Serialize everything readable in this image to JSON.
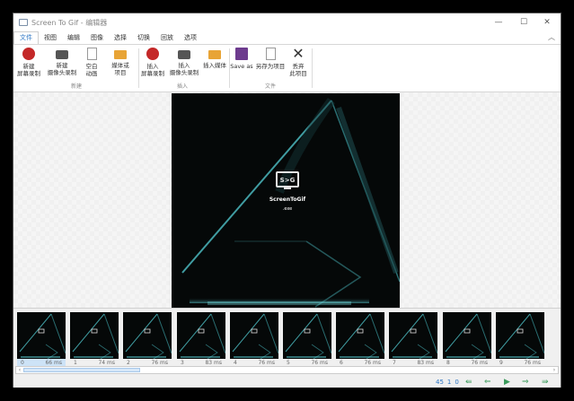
{
  "window": {
    "title": "Screen To Gif - 编辑器"
  },
  "controls": {
    "minimize": "—",
    "maximize": "☐",
    "close": "✕"
  },
  "tabs": [
    "文件",
    "视图",
    "编辑",
    "图像",
    "选择",
    "切换",
    "回放",
    "选项"
  ],
  "ribbon": {
    "new_group": "新建",
    "insert_group": "插入",
    "file_group": "文件",
    "buttons": [
      {
        "line1": "新建",
        "line2": "屏幕录制",
        "icon": "record-icon"
      },
      {
        "line1": "新建",
        "line2": "摄像头录制",
        "icon": "camera-icon"
      },
      {
        "line1": "空白",
        "line2": "动画",
        "icon": "blank-page-icon"
      },
      {
        "line1": "媒体或",
        "line2": "项目",
        "icon": "folder-icon"
      },
      {
        "line1": "插入",
        "line2": "屏幕录制",
        "icon": "record-add-icon"
      },
      {
        "line1": "插入",
        "line2": "摄像头录制",
        "icon": "camera-add-icon"
      },
      {
        "line1": "插入媒体",
        "line2": "",
        "icon": "folder-insert-icon"
      },
      {
        "line1": "Save as",
        "line2": "",
        "icon": "save-icon"
      },
      {
        "line1": "另存为项目",
        "line2": "",
        "icon": "project-file-icon"
      },
      {
        "line1": "丢弃",
        "line2": "此项目",
        "icon": "discard-icon"
      }
    ]
  },
  "frame": {
    "logo_title": "ScreenToGif",
    "logo_sub": ".exe"
  },
  "timeline": {
    "frames": [
      {
        "index": "0",
        "delay": "66 ms"
      },
      {
        "index": "1",
        "delay": "74 ms"
      },
      {
        "index": "2",
        "delay": "76 ms"
      },
      {
        "index": "3",
        "delay": "83 ms"
      },
      {
        "index": "4",
        "delay": "76 ms"
      },
      {
        "index": "5",
        "delay": "76 ms"
      },
      {
        "index": "6",
        "delay": "76 ms"
      },
      {
        "index": "7",
        "delay": "83 ms"
      },
      {
        "index": "8",
        "delay": "76 ms"
      },
      {
        "index": "9",
        "delay": "76 ms"
      }
    ]
  },
  "status": {
    "frame_count": "45",
    "selected_count": "1",
    "current_index": "0"
  },
  "colors": {
    "accent": "#2b74c3",
    "nav_green": "#3a9a5a",
    "record_red": "#c42828"
  }
}
